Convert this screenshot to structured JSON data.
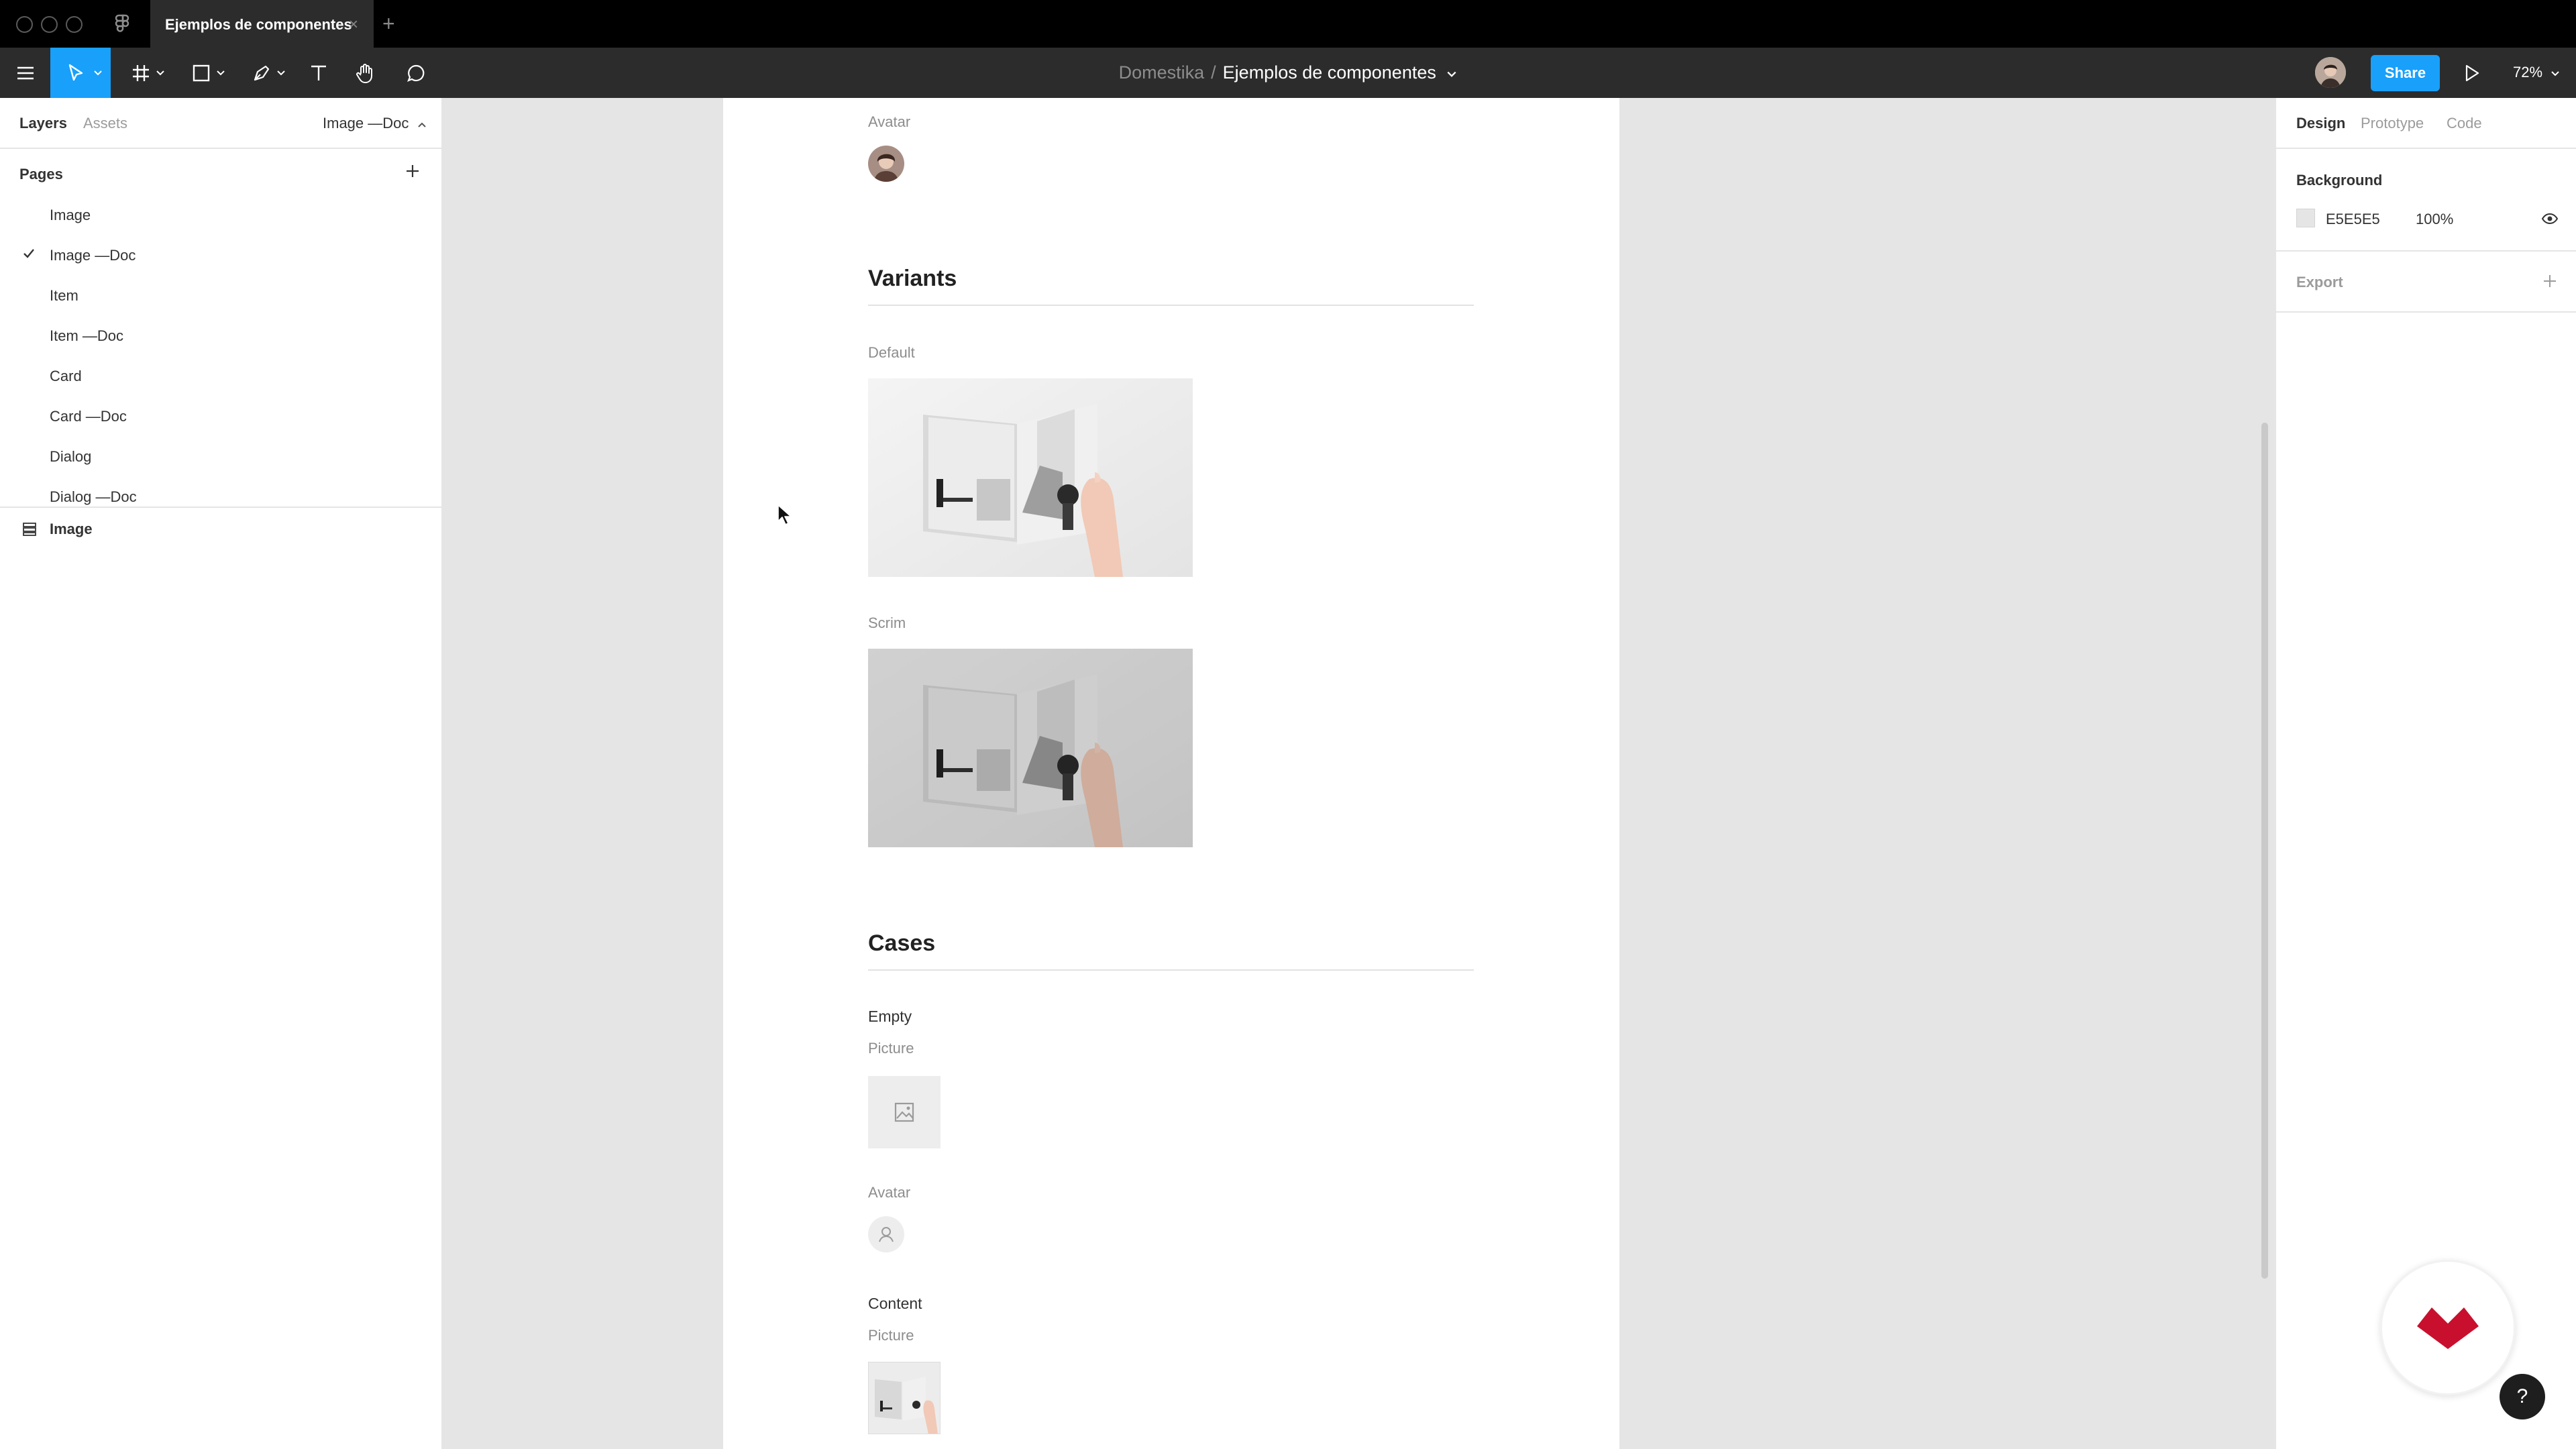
{
  "window": {
    "tab_title": "Ejemplos de componentes",
    "tab_close": "×",
    "new_tab": "+"
  },
  "toolbar": {
    "breadcrumb_project": "Domestika",
    "breadcrumb_separator": "/",
    "breadcrumb_file": "Ejemplos de componentes",
    "share_label": "Share",
    "zoom_level": "72%"
  },
  "left_panel": {
    "tab_layers": "Layers",
    "tab_assets": "Assets",
    "current_page": "Image —Doc",
    "pages_title": "Pages",
    "pages": [
      {
        "label": "Image",
        "active": false
      },
      {
        "label": "Image —Doc",
        "active": true
      },
      {
        "label": "Item",
        "active": false
      },
      {
        "label": "Item —Doc",
        "active": false
      },
      {
        "label": "Card",
        "active": false
      },
      {
        "label": "Card —Doc",
        "active": false
      },
      {
        "label": "Dialog",
        "active": false
      },
      {
        "label": "Dialog —Doc",
        "active": false
      }
    ],
    "layers": [
      {
        "label": "Image"
      }
    ]
  },
  "canvas": {
    "top_avatar_caption": "Avatar",
    "variants_heading": "Variants",
    "default_caption": "Default",
    "scrim_caption": "Scrim",
    "cases_heading": "Cases",
    "empty_label": "Empty",
    "empty_picture_caption": "Picture",
    "empty_avatar_caption": "Avatar",
    "content_label": "Content",
    "content_picture_caption": "Picture"
  },
  "right_panel": {
    "tab_design": "Design",
    "tab_prototype": "Prototype",
    "tab_code": "Code",
    "background_title": "Background",
    "background_hex": "E5E5E5",
    "background_opacity": "100%",
    "export_title": "Export"
  },
  "overlays": {
    "help_label": "?"
  },
  "colors": {
    "accent": "#18a0fb",
    "toolbar": "#2c2c2c",
    "canvas_bg": "#e5e5e5",
    "brand_red": "#c8102e"
  }
}
